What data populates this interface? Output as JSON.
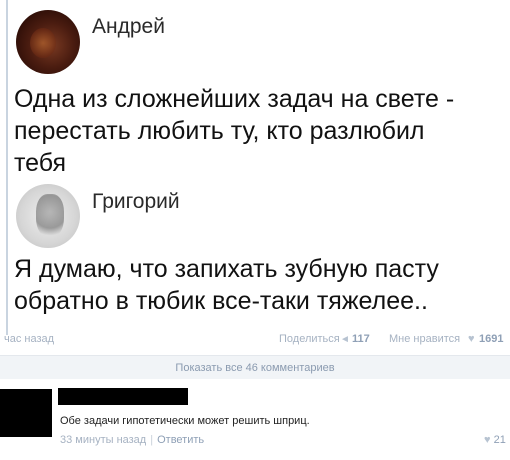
{
  "post1": {
    "author": "Андрей",
    "line1": "Одна из сложнейших задач на свете -",
    "line2": "перестать любить ту, кто разлюбил",
    "line3": "тебя"
  },
  "post2": {
    "author": "Григорий",
    "line1": "Я думаю, что запихать зубную пасту",
    "line2": "обратно в тюбик все-таки тяжелее.."
  },
  "meta": {
    "time": "час назад",
    "share_label": "Поделиться",
    "share_count": "117",
    "like_label": "Мне нравится",
    "like_count": "1691"
  },
  "show_comments_label": "Показать все 46 комментариев",
  "comment": {
    "text": "Обе задачи гипотетически может решить шприц.",
    "time": "33 минуты назад",
    "separator": "|",
    "reply_label": "Ответить",
    "like_count": "21"
  },
  "icons": {
    "share": "megaphone-icon",
    "like": "heart-icon"
  },
  "colors": {
    "link": "#8fa0b6",
    "muted": "#a6b2c2",
    "redaction": "#000000"
  }
}
